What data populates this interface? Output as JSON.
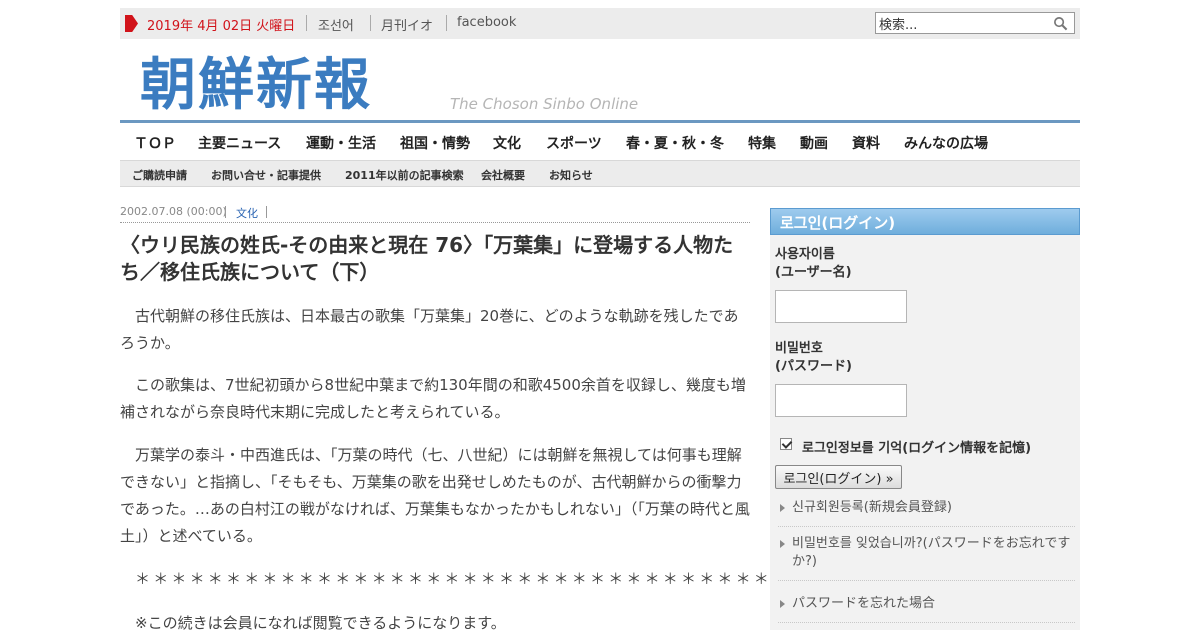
{
  "topbar": {
    "date": "2019年 4月 02日 火曜日",
    "links": [
      "조선어",
      "月刊イオ",
      "facebook"
    ],
    "search_placeholder": "検索...",
    "search_value": "検索...",
    "accent_color": "#d1131a"
  },
  "logo": {
    "title": "朝鮮新報",
    "subtitle": "The Choson Sinbo Online"
  },
  "main_nav": [
    "ＴＯＰ",
    "主要ニュース",
    "運動・生活",
    "祖国・情勢",
    "文化",
    "スポーツ",
    "春・夏・秋・冬",
    "特集",
    "動画",
    "資料",
    "みんなの広場"
  ],
  "sub_nav": [
    "ご購読申請",
    "お問い合せ・記事提供",
    "2011年以前の記事検索",
    "会社概要",
    "お知らせ"
  ],
  "article": {
    "date": "2002.07.08  (00:00)",
    "category": "文化",
    "title": "〈ウリ民族の姓氏-その由来と現在 76〉「万葉集」に登場する人物たち／移住氏族について（下）",
    "paragraphs": [
      "古代朝鮮の移住氏族は、日本最古の歌集「万葉集」20巻に、どのような軌跡を残したであろうか。",
      "この歌集は、7世紀初頭から8世紀中葉まで約130年間の和歌4500余首を収録し、幾度も増補されながら奈良時代末期に完成したと考えられている。",
      "万葉学の泰斗・中西進氏は、「万葉の時代（七、八世紀）には朝鮮を無視しては何事も理解できない」と指摘し、「そもそも、万葉集の歌を出発せしめたものが、古代朝鮮からの衝撃力であった。…あの白村江の戦がなければ、万葉集もなかったかもしれない」（「万葉の時代と風土」）と述べている。"
    ],
    "stars": "＊＊＊＊＊＊＊＊＊＊＊＊＊＊＊＊＊＊＊＊＊＊＊＊＊＊＊＊＊＊＊＊＊＊＊＊＊＊＊＊",
    "note": "※この続きは会員になれば閲覧できるようになります。"
  },
  "sidebar": {
    "header": "로그인(ログイン)",
    "username_label_1": "사용자이름",
    "username_label_2": "(ユーザー名)",
    "password_label_1": "비밀번호",
    "password_label_2": "(パスワード)",
    "remember_label": "로그인정보를 기억(ログイン情報を記憶)",
    "remember_checked": true,
    "login_button": "로그인(ログイン) »",
    "links": [
      "신규회원등록(新規会員登録)",
      "비밀번호를 잊었습니까?(パスワードをお忘れですか?)",
      "パスワードを忘れた場合"
    ]
  }
}
